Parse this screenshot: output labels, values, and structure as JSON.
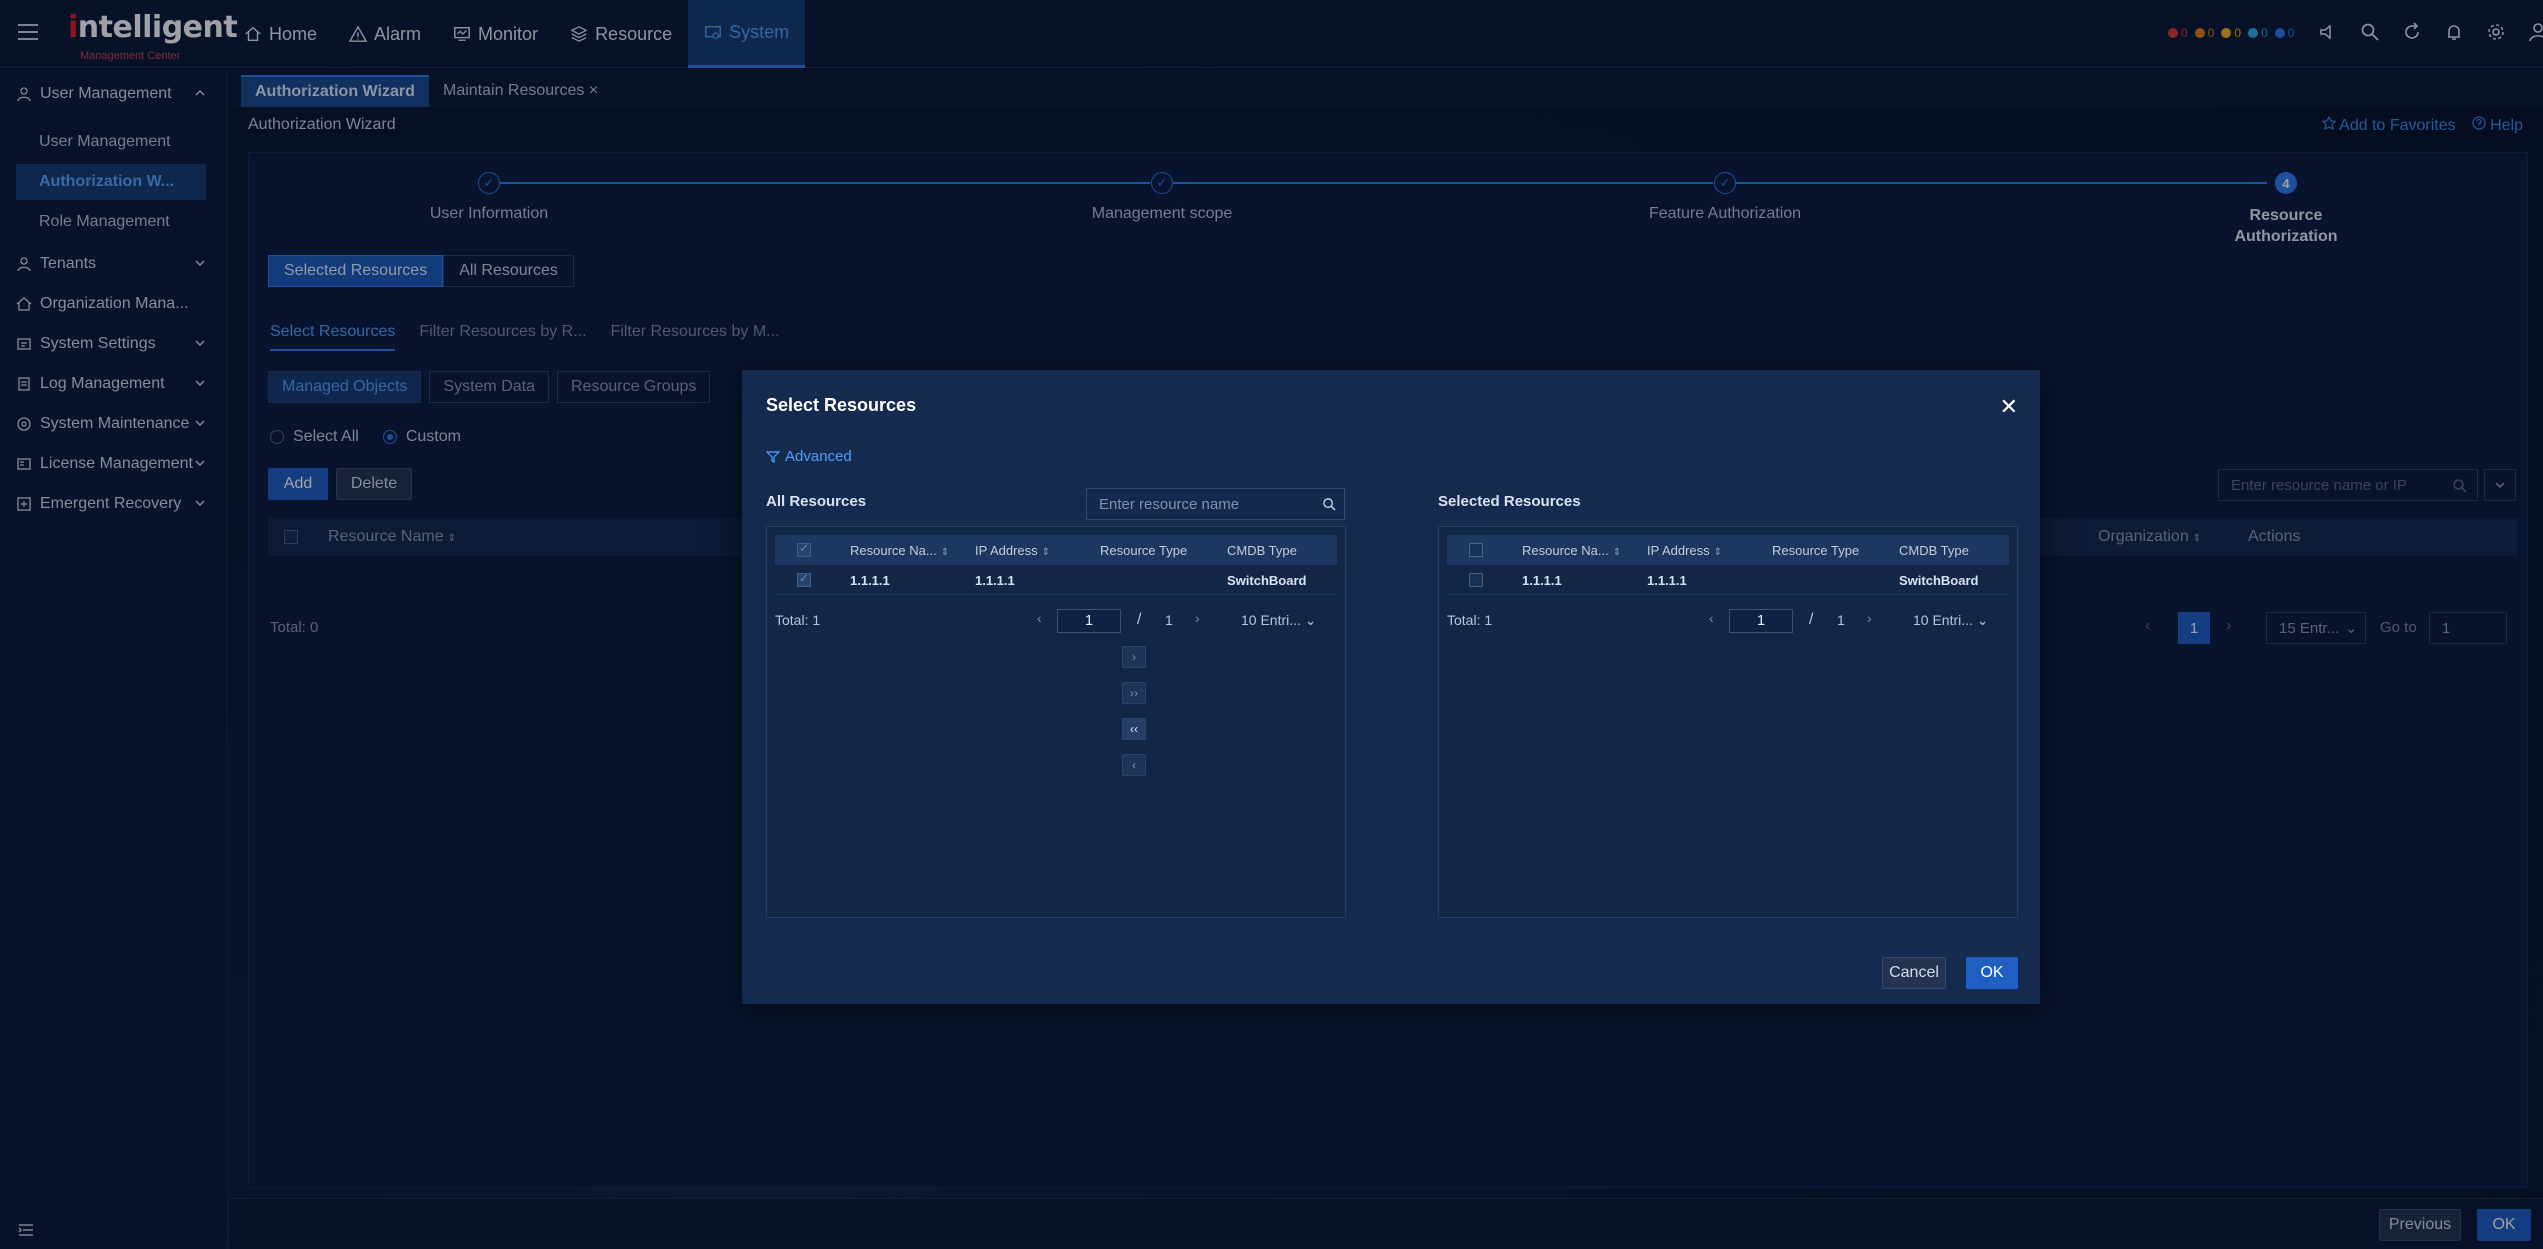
{
  "app": {
    "logo_main": "ntelligent",
    "logo_prefix": "i",
    "logo_sub": "Management Center"
  },
  "nav": {
    "items": [
      {
        "label": "Home",
        "icon": "home-icon"
      },
      {
        "label": "Alarm",
        "icon": "alarm-icon"
      },
      {
        "label": "Monitor",
        "icon": "monitor-icon"
      },
      {
        "label": "Resource",
        "icon": "resource-icon"
      },
      {
        "label": "System",
        "icon": "system-icon",
        "active": true
      }
    ],
    "alarm_counts": [
      {
        "color": "#e0392f",
        "count": "0"
      },
      {
        "color": "#f07b1d",
        "count": "0"
      },
      {
        "color": "#f2b51e",
        "count": "0"
      },
      {
        "color": "#27b3e8",
        "count": "0"
      },
      {
        "color": "#2f7cf6",
        "count": "0"
      }
    ]
  },
  "sidebar": {
    "groups": [
      {
        "label": "User Management",
        "expanded": true
      },
      {
        "label": "Tenants"
      },
      {
        "label": "Organization Mana..."
      },
      {
        "label": "System Settings"
      },
      {
        "label": "Log Management"
      },
      {
        "label": "System Maintenance"
      },
      {
        "label": "License Management"
      },
      {
        "label": "Emergent Recovery"
      }
    ],
    "sub_items": [
      {
        "label": "User Management"
      },
      {
        "label": "Authorization W...",
        "active": true
      },
      {
        "label": "Role Management"
      }
    ]
  },
  "tabs": [
    {
      "label": "Authorization Wizard",
      "active": true
    },
    {
      "label": "Maintain Resources ×"
    }
  ],
  "page": {
    "title": "Authorization Wizard",
    "add_favorites": "Add to Favorites",
    "help": "Help"
  },
  "wizard": {
    "steps": [
      {
        "label": "User Information",
        "mark": "✓"
      },
      {
        "label": "Management scope",
        "mark": "✓"
      },
      {
        "label": "Feature Authorization",
        "mark": "✓"
      },
      {
        "label_line1": "Resource",
        "label_line2": "Authorization",
        "mark": "4",
        "current": true
      }
    ]
  },
  "resources": {
    "segment": [
      "Selected Resources",
      "All Resources"
    ],
    "subtabs": [
      "Select Resources",
      "Filter Resources by R...",
      "Filter Resources by M..."
    ],
    "pilltabs": [
      "Managed Objects",
      "System Data",
      "Resource Groups"
    ],
    "radio": [
      "Select All",
      "Custom"
    ],
    "add": "Add",
    "delete": "Delete",
    "search_placeholder": "Enter resource name or IP",
    "columns": {
      "name": "Resource Name",
      "organization": "Organization",
      "actions": "Actions"
    },
    "total": "Total: 0",
    "page": "1",
    "page_size": "15 Entr...",
    "goto_label": "Go to",
    "goto_value": "1"
  },
  "footer": {
    "previous": "Previous",
    "ok": "OK"
  },
  "modal": {
    "title": "Select Resources",
    "advanced": "Advanced",
    "left": {
      "label": "All Resources",
      "search_placeholder": "Enter resource name",
      "columns": [
        "Resource Na...",
        "IP Address",
        "Resource Type",
        "CMDB Type"
      ],
      "rows": [
        {
          "name": "1.1.1.1",
          "ip": "1.1.1.1",
          "type": "",
          "cmdb": "SwitchBoard",
          "checked": true
        }
      ],
      "total": "Total: 1",
      "page": "1",
      "pages": "1",
      "page_size": "10 Entri..."
    },
    "right": {
      "label": "Selected Resources",
      "columns": [
        "Resource Na...",
        "IP Address",
        "Resource Type",
        "CMDB Type"
      ],
      "rows": [
        {
          "name": "1.1.1.1",
          "ip": "1.1.1.1",
          "type": "",
          "cmdb": "SwitchBoard",
          "checked": false
        }
      ],
      "total": "Total: 1",
      "page": "1",
      "pages": "1",
      "page_size": "10 Entri..."
    },
    "cancel": "Cancel",
    "ok": "OK"
  }
}
